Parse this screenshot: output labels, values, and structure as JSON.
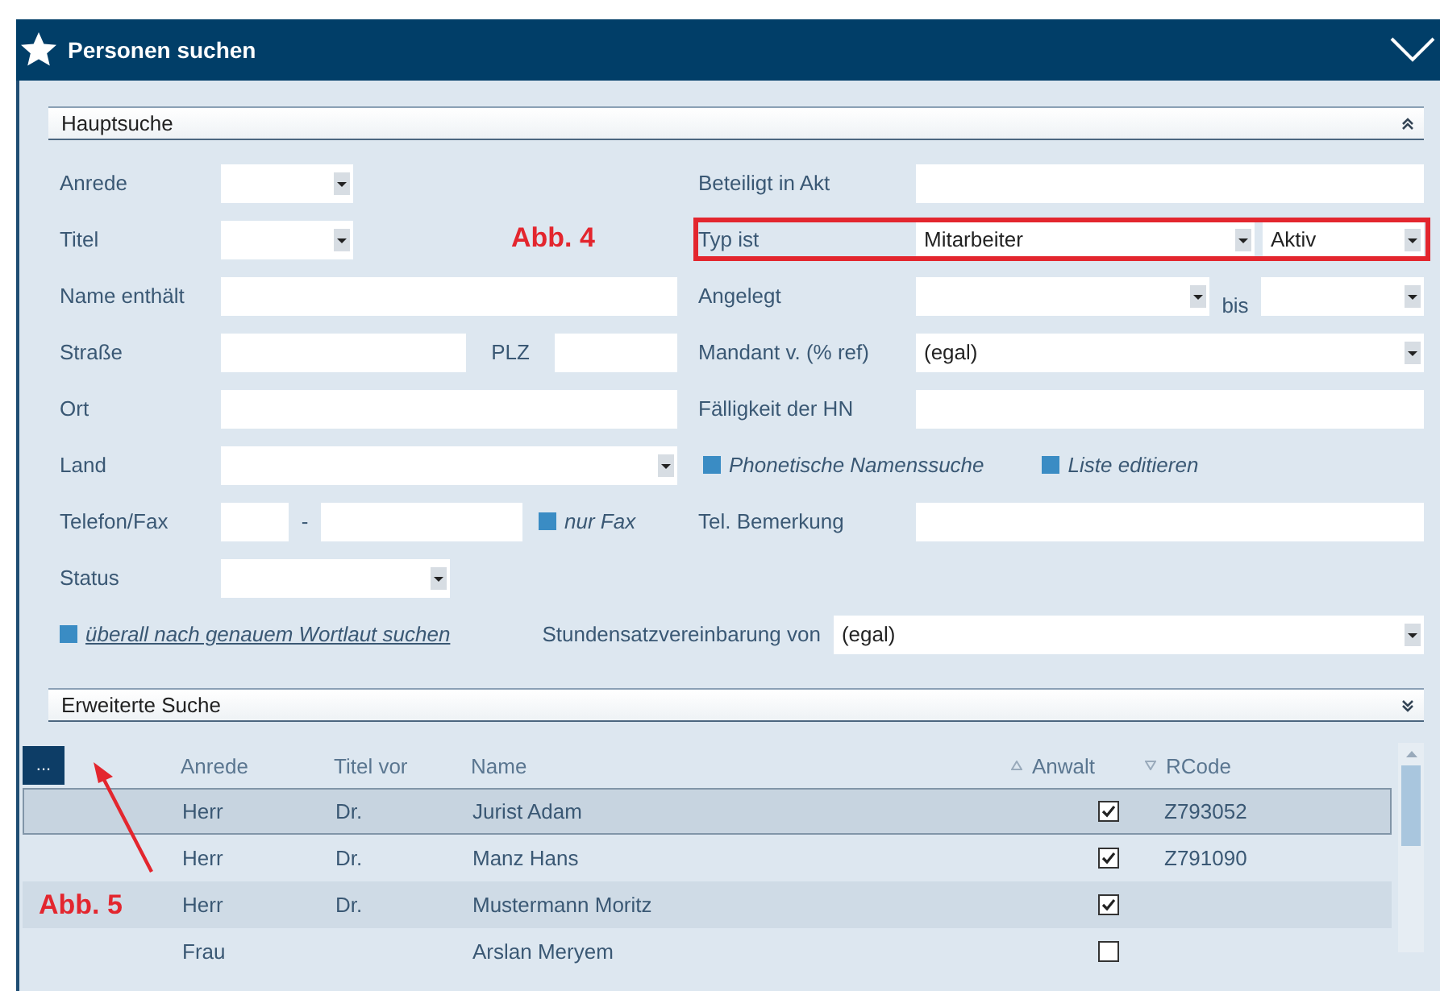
{
  "window": {
    "title": "Personen suchen"
  },
  "main_search": {
    "title": "Hauptsuche",
    "left_rows": [
      {
        "label": "Anrede",
        "controls": [
          {
            "kind": "dropdown"
          }
        ]
      },
      {
        "label": "Titel",
        "callout": "Abb. 4",
        "controls": [
          {
            "kind": "dropdown"
          }
        ]
      },
      {
        "label": "Name enthält",
        "controls": [
          {
            "kind": "textbox"
          }
        ]
      },
      {
        "label": "Straße",
        "controls": [
          {
            "kind": "textbox"
          },
          {
            "kind": "text",
            "text": "PLZ"
          },
          {
            "kind": "textbox"
          }
        ]
      },
      {
        "label": "Ort",
        "controls": [
          {
            "kind": "textbox"
          }
        ]
      },
      {
        "label": "Land",
        "controls": [
          {
            "kind": "dropdown"
          }
        ]
      },
      {
        "label": "Telefon/Fax",
        "controls": [
          {
            "kind": "textbox"
          },
          {
            "kind": "text",
            "text": "-"
          },
          {
            "kind": "textbox"
          },
          {
            "kind": "checkbox",
            "text": "nur Fax",
            "checked": true
          }
        ]
      },
      {
        "label": "Status",
        "controls": [
          {
            "kind": "dropdown"
          }
        ]
      }
    ],
    "right_rows": [
      {
        "label": "Beteiligt in Akt",
        "controls": [
          {
            "kind": "textbox"
          }
        ]
      },
      {
        "label": "Typ ist",
        "highlight": true,
        "controls": [
          {
            "kind": "dropdown",
            "value": "Mitarbeiter"
          },
          {
            "kind": "dropdown",
            "value": "Aktiv"
          }
        ]
      },
      {
        "label": "Angelegt",
        "controls": [
          {
            "kind": "dropdown"
          },
          {
            "kind": "text",
            "text": "bis"
          },
          {
            "kind": "dropdown"
          }
        ]
      },
      {
        "label": "Mandant v. (% ref)",
        "controls": [
          {
            "kind": "dropdown",
            "value": "(egal)"
          }
        ]
      },
      {
        "label": "Fälligkeit der HN",
        "controls": [
          {
            "kind": "textbox"
          }
        ]
      },
      {
        "controls": [
          {
            "kind": "checkbox",
            "text": "Phonetische Namenssuche",
            "checked": true
          },
          {
            "kind": "checkbox",
            "text": "Liste editieren",
            "checked": true
          }
        ]
      },
      {
        "label": "Tel. Bemerkung",
        "controls": [
          {
            "kind": "textbox"
          }
        ]
      }
    ],
    "exact_search": {
      "text": "überall nach genauem Wortlaut suchen",
      "checked": true
    },
    "rate_label": "Stundensatzvereinbarung von",
    "rate_value": "(egal)"
  },
  "extended_search": {
    "title": "Erweiterte Suche"
  },
  "table": {
    "menu_button": "...",
    "callout": "Abb. 5",
    "columns": [
      {
        "label": "Anrede"
      },
      {
        "label": "Titel vor"
      },
      {
        "label": "Name"
      },
      {
        "label": "Anwalt",
        "sort_ascending": true
      },
      {
        "label": "RCode",
        "sort_ascending": false
      }
    ],
    "rows": [
      {
        "anrede": "Herr",
        "titel_vor": "Dr.",
        "name": "Jurist Adam",
        "anwalt": true,
        "rcode": "Z793052",
        "selected": true
      },
      {
        "anrede": "Herr",
        "titel_vor": "Dr.",
        "name": "Manz Hans",
        "anwalt": true,
        "rcode": "Z791090",
        "selected": false
      },
      {
        "anrede": "Herr",
        "titel_vor": "Dr.",
        "name": "Mustermann Moritz",
        "anwalt": true,
        "selected": false
      },
      {
        "anrede": "Frau",
        "name": "Arslan Meryem",
        "anwalt": false,
        "selected": false
      }
    ]
  }
}
